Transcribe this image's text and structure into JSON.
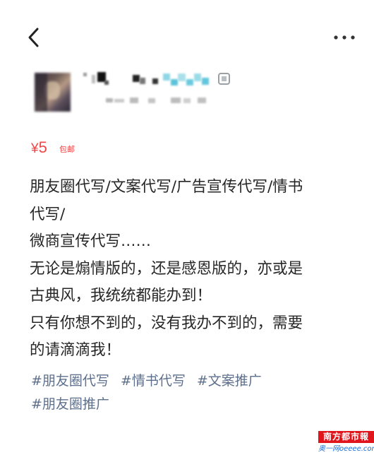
{
  "header": {
    "back_icon": "chevron-left-icon",
    "more_icon": "more-dots-icon"
  },
  "user": {
    "avatar": "blurred-avatar",
    "verified_icon": "badge-icon"
  },
  "listing": {
    "price_symbol": "¥",
    "price_value": "5",
    "free_shipping": "包邮",
    "accent_color": "#ef4747"
  },
  "description": {
    "lines": [
      "朋友圈代写/文案代写/广告宣传代写/情书",
      "代写/",
      "微商宣传代写……",
      "无论是煽情版的，还是感恩版的，亦或是",
      "古典风，我统统都能办到！",
      "只有你想不到的，没有我办不到的，需要",
      "的请滴滴我！"
    ]
  },
  "tags": [
    "#朋友圈代写",
    "#情书代写",
    "#文案推广",
    "#朋友圈推广"
  ],
  "tag_color": "#5d6f8c",
  "watermark": {
    "title": "南方都市報",
    "subtitle": "奥一网oeeee.com"
  }
}
